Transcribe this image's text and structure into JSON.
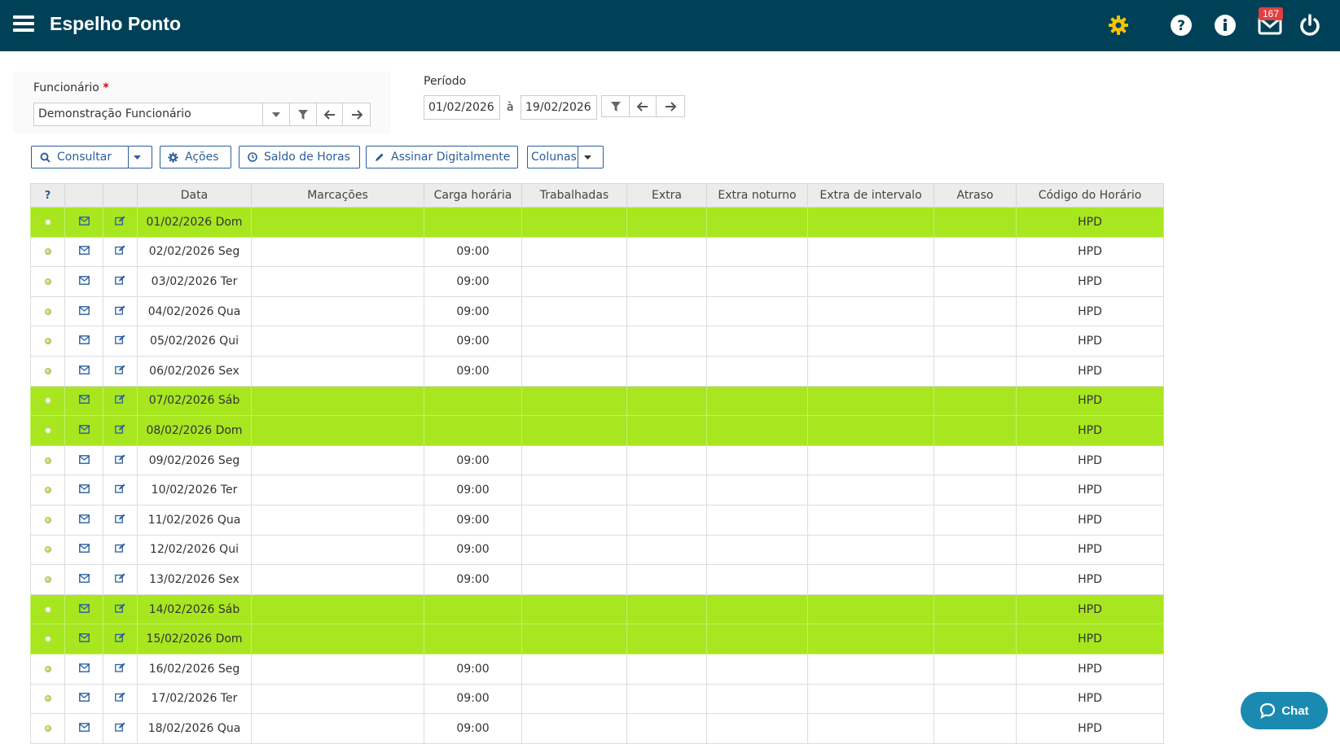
{
  "header": {
    "title": "Espelho Ponto",
    "mail_badge": "167"
  },
  "filters": {
    "employee_label": "Funcionário",
    "employee_required_mark": "*",
    "employee_value": "Demonstração Funcionário",
    "period_label": "Período",
    "date_from": "01/02/2026",
    "date_sep": "à",
    "date_to": "19/02/2026"
  },
  "actions": {
    "consultar": "Consultar",
    "acoes": "Ações",
    "saldo": "Saldo de Horas",
    "assinar": "Assinar Digitalmente",
    "colunas": "Colunas"
  },
  "table": {
    "help_header": "?",
    "columns": [
      "Data",
      "Marcações",
      "Carga horária",
      "Trabalhadas",
      "Extra",
      "Extra noturno",
      "Extra de intervalo",
      "Atraso",
      "Código do Horário"
    ],
    "rows": [
      {
        "date": "01/02/2026 Dom",
        "carga": "",
        "codigo": "HPD",
        "highlight": true
      },
      {
        "date": "02/02/2026 Seg",
        "carga": "09:00",
        "codigo": "HPD",
        "highlight": false
      },
      {
        "date": "03/02/2026 Ter",
        "carga": "09:00",
        "codigo": "HPD",
        "highlight": false
      },
      {
        "date": "04/02/2026 Qua",
        "carga": "09:00",
        "codigo": "HPD",
        "highlight": false
      },
      {
        "date": "05/02/2026 Qui",
        "carga": "09:00",
        "codigo": "HPD",
        "highlight": false
      },
      {
        "date": "06/02/2026 Sex",
        "carga": "09:00",
        "codigo": "HPD",
        "highlight": false
      },
      {
        "date": "07/02/2026 Sáb",
        "carga": "",
        "codigo": "HPD",
        "highlight": true
      },
      {
        "date": "08/02/2026 Dom",
        "carga": "",
        "codigo": "HPD",
        "highlight": true
      },
      {
        "date": "09/02/2026 Seg",
        "carga": "09:00",
        "codigo": "HPD",
        "highlight": false
      },
      {
        "date": "10/02/2026 Ter",
        "carga": "09:00",
        "codigo": "HPD",
        "highlight": false
      },
      {
        "date": "11/02/2026 Qua",
        "carga": "09:00",
        "codigo": "HPD",
        "highlight": false
      },
      {
        "date": "12/02/2026 Qui",
        "carga": "09:00",
        "codigo": "HPD",
        "highlight": false
      },
      {
        "date": "13/02/2026 Sex",
        "carga": "09:00",
        "codigo": "HPD",
        "highlight": false
      },
      {
        "date": "14/02/2026 Sáb",
        "carga": "",
        "codigo": "HPD",
        "highlight": true
      },
      {
        "date": "15/02/2026 Dom",
        "carga": "",
        "codigo": "HPD",
        "highlight": true
      },
      {
        "date": "16/02/2026 Seg",
        "carga": "09:00",
        "codigo": "HPD",
        "highlight": false
      },
      {
        "date": "17/02/2026 Ter",
        "carga": "09:00",
        "codigo": "HPD",
        "highlight": false
      },
      {
        "date": "18/02/2026 Qua",
        "carga": "09:00",
        "codigo": "HPD",
        "highlight": false
      }
    ]
  },
  "chat": {
    "label": "Chat"
  },
  "colors": {
    "topbar": "#004158",
    "weekend_row": "#a8e620",
    "accent": "#2b5f9e",
    "gear": "#f5c400"
  }
}
